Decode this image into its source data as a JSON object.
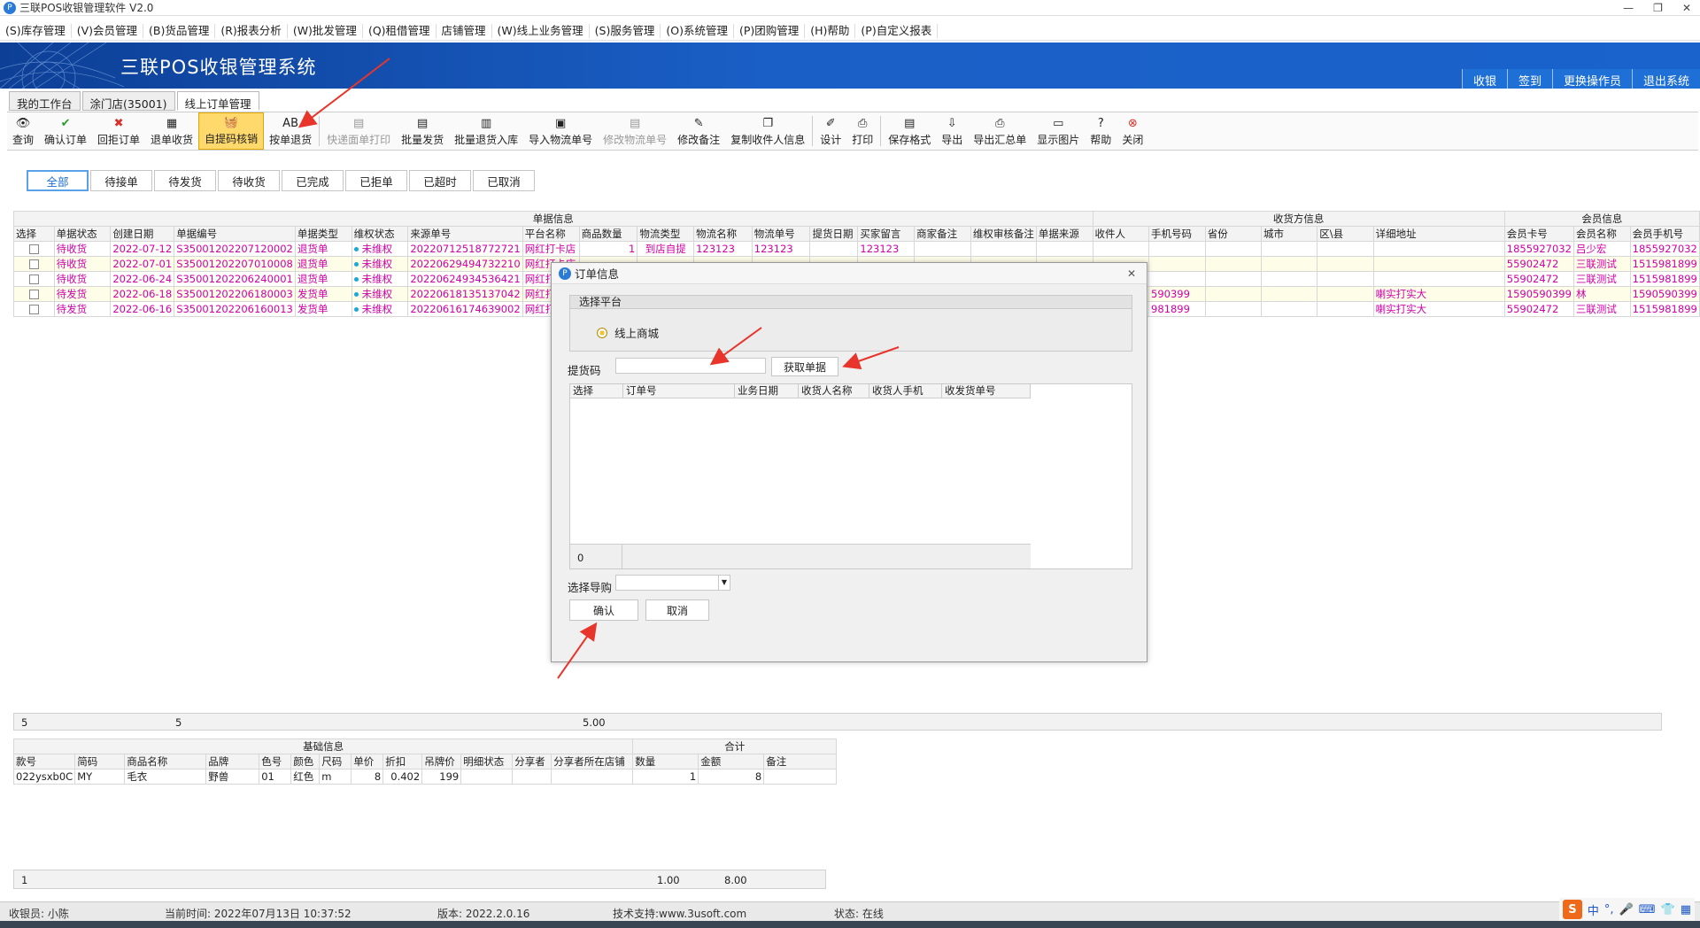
{
  "window": {
    "title": "三联POS收银管理软件 V2.0",
    "buttons": [
      "—",
      "❐",
      "✕"
    ]
  },
  "menu": [
    "(S)库存管理",
    "(V)会员管理",
    "(B)货品管理",
    "(R)报表分析",
    "(W)批发管理",
    "(Q)租借管理",
    "店铺管理",
    "(W)线上业务管理",
    "(S)服务管理",
    "(O)系统管理",
    "(P)团购管理",
    "(H)帮助",
    "(P)自定义报表"
  ],
  "banner": {
    "title": "三联POS收银管理系统",
    "nav": [
      "收银",
      "签到",
      "更换操作员",
      "退出系统"
    ]
  },
  "tabs": [
    "我的工作台",
    "涂门店(35001)",
    "线上订单管理"
  ],
  "toolbar": [
    {
      "label": "查询",
      "icon": "eye-icon"
    },
    {
      "label": "确认订单",
      "icon": "check-icon"
    },
    {
      "label": "回拒订单",
      "icon": "reject-icon"
    },
    {
      "label": "退单收货",
      "icon": "receive-icon"
    },
    {
      "label": "自提码核销",
      "icon": "basket-icon",
      "highlight": true
    },
    {
      "label": "按单退货",
      "icon": "ab-icon"
    },
    {
      "label": "快递面单打印",
      "icon": "print-label-icon",
      "disabled": true
    },
    {
      "label": "批量发货",
      "icon": "batch-ship-icon"
    },
    {
      "label": "批量退货入库",
      "icon": "batch-return-icon"
    },
    {
      "label": "导入物流单号",
      "icon": "import-icon"
    },
    {
      "label": "修改物流单号",
      "icon": "edit-logistics-icon",
      "disabled": true
    },
    {
      "label": "修改备注",
      "icon": "edit-note-icon"
    },
    {
      "label": "复制收件人信息",
      "icon": "copy-icon"
    },
    {
      "label": "设计",
      "icon": "design-icon"
    },
    {
      "label": "打印",
      "icon": "print-icon"
    },
    {
      "label": "保存格式",
      "icon": "save-format-icon"
    },
    {
      "label": "导出",
      "icon": "export-icon"
    },
    {
      "label": "导出汇总单",
      "icon": "export-summary-icon"
    },
    {
      "label": "显示图片",
      "icon": "picture-icon"
    },
    {
      "label": "帮助",
      "icon": "help-icon"
    },
    {
      "label": "关闭",
      "icon": "close-icon"
    }
  ],
  "filters": [
    "全部",
    "待接单",
    "待发货",
    "待收货",
    "已完成",
    "已拒单",
    "已超时",
    "已取消"
  ],
  "grid": {
    "groups": [
      "单据信息",
      "收货方信息",
      "会员信息"
    ],
    "columns": [
      "选择",
      "单据状态",
      "创建日期",
      "单据编号",
      "单据类型",
      "维权状态",
      "来源单号",
      "平台名称",
      "商品数量",
      "物流类型",
      "物流名称",
      "物流单号",
      "提货日期",
      "买家留言",
      "商家备注",
      "维权审核备注",
      "单据来源",
      "收件人",
      "手机号码",
      "省份",
      "城市",
      "区\\县",
      "详细地址",
      "会员卡号",
      "会员名称",
      "会员手机号"
    ],
    "rows": [
      [
        "",
        "待收货",
        "2022-07-12",
        "S35001202207120002",
        "退货单",
        "未维权",
        "20220712518772721",
        "网红打卡店",
        "1",
        "到店自提",
        "123123",
        "123123",
        "",
        "123123",
        "",
        "",
        "",
        "",
        "",
        "",
        "",
        "",
        "",
        "1855927032",
        "吕少宏",
        "1855927032"
      ],
      [
        "",
        "待收货",
        "2022-07-01",
        "S35001202207010008",
        "退货单",
        "未维权",
        "20220629494732210",
        "网红打卡店",
        "",
        "",
        "",
        "",
        "",
        "",
        "",
        "",
        "",
        "",
        "",
        "",
        "",
        "",
        "",
        "55902472",
        "三联测试",
        "1515981899"
      ],
      [
        "",
        "待收货",
        "2022-06-24",
        "S35001202206240001",
        "退货单",
        "未维权",
        "20220624934536421",
        "网红打卡店",
        "",
        "",
        "",
        "",
        "",
        "",
        "",
        "",
        "",
        "",
        "",
        "",
        "",
        "",
        "",
        "55902472",
        "三联测试",
        "1515981899"
      ],
      [
        "",
        "待发货",
        "2022-06-18",
        "S35001202206180003",
        "发货单",
        "未维权",
        "20220618135137042",
        "网红打卡店",
        "",
        "",
        "",
        "",
        "",
        "",
        "",
        "",
        "",
        "",
        "590399",
        "",
        "",
        "",
        "喇实打实大",
        "1590590399",
        "林",
        "1590590399"
      ],
      [
        "",
        "待发货",
        "2022-06-16",
        "S35001202206160013",
        "发货单",
        "未维权",
        "20220616174639002",
        "网红打卡店",
        "",
        "",
        "",
        "",
        "",
        "",
        "",
        "",
        "",
        "",
        "981899",
        "",
        "",
        "",
        "喇实打实大",
        "55902472",
        "三联测试",
        "1515981899"
      ]
    ],
    "summary": {
      "count": "5",
      "docs": "5",
      "qty": "5.00"
    }
  },
  "grid2": {
    "groups": [
      "基础信息",
      "合计"
    ],
    "columns": [
      "款号",
      "简码",
      "商品名称",
      "品牌",
      "色号",
      "颜色",
      "尺码",
      "单价",
      "折扣",
      "吊牌价",
      "明细状态",
      "分享者",
      "分享者所在店铺",
      "数量",
      "金额",
      "备注"
    ],
    "rows": [
      [
        "022ysxb0C",
        "MY",
        "毛衣",
        "野兽",
        "01",
        "红色",
        "m",
        "8",
        "0.402",
        "199",
        "",
        "",
        "",
        "1",
        "8",
        ""
      ]
    ],
    "summary": {
      "count": "1",
      "qty": "1.00",
      "amount": "8.00"
    }
  },
  "dialog": {
    "title": "订单信息",
    "platform_group": "选择平台",
    "platform_option": "线上商城",
    "pickup_label": "提货码",
    "pickup_value": "",
    "fetch_button": "获取单据",
    "order_columns": [
      "选择",
      "订单号",
      "业务日期",
      "收货人名称",
      "收货人手机",
      "收发货单号"
    ],
    "order_count": "0",
    "guide_label": "选择导购",
    "guide_value": "",
    "confirm": "确认",
    "cancel": "取消"
  },
  "status": {
    "cashier": "收银员: 小陈",
    "time": "当前时间: 2022年07月13日 10:37:52",
    "version": "版本: 2022.2.0.16",
    "support": "技术支持:www.3usoft.com",
    "state": "状态: 在线"
  },
  "ime": {
    "logo": "S",
    "lang": "中",
    "punct": "°,"
  },
  "colors": {
    "banner": "#1a5fc6",
    "pink": "#d000a8",
    "highlight": "#ffd96b",
    "arrow": "#e8352b"
  }
}
